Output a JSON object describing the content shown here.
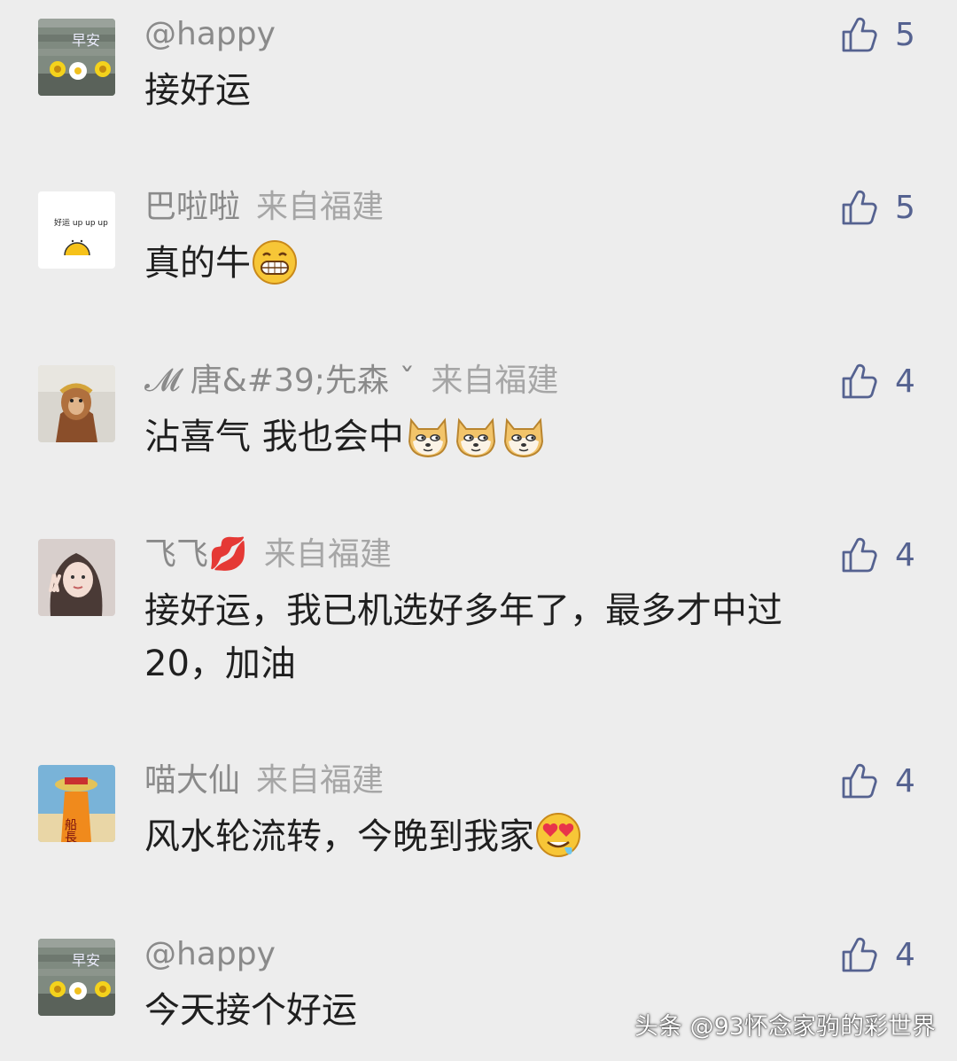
{
  "comments": [
    {
      "user": "@happy",
      "location": "",
      "text": "接好运",
      "likes": "5",
      "avatar_icon": "morning-photo-avatar",
      "emoji_icons": []
    },
    {
      "user": "巴啦啦",
      "location": "来自福建",
      "text": "真的牛",
      "likes": "5",
      "avatar_icon": "good-luck-sticker-avatar",
      "avatar_text": "好运 up up up",
      "emoji_icons": [
        "grin-emoji"
      ]
    },
    {
      "user": "𝓜 唐&#39;先森 ˇ",
      "location": "来自福建",
      "text": "沾喜气 我也会中",
      "likes": "4",
      "avatar_icon": "monkey-king-avatar",
      "emoji_icons": [
        "doge-emoji",
        "doge-emoji",
        "doge-emoji"
      ]
    },
    {
      "user": "飞飞💋",
      "location": "来自福建",
      "text": "接好运，我已机选好多年了，最多才中过20，加油",
      "likes": "4",
      "avatar_icon": "girl-photo-avatar",
      "emoji_icons": []
    },
    {
      "user": "喵大仙",
      "location": "来自福建",
      "text": "风水轮流转，今晚到我家",
      "likes": "4",
      "avatar_icon": "captain-figure-avatar",
      "avatar_text": "船長",
      "emoji_icons": [
        "heart-eyes-emoji"
      ]
    },
    {
      "user": "@happy",
      "location": "",
      "text": "今天接个好运",
      "likes": "4",
      "avatar_icon": "morning-photo-avatar",
      "emoji_icons": []
    }
  ],
  "avatar_morning_text": "早安",
  "watermark": "头条 @93怀念家驹的彩世界",
  "colors": {
    "background": "#ededed",
    "like": "#556290",
    "username": "#8a8a8a",
    "text": "#1f1f1f"
  }
}
